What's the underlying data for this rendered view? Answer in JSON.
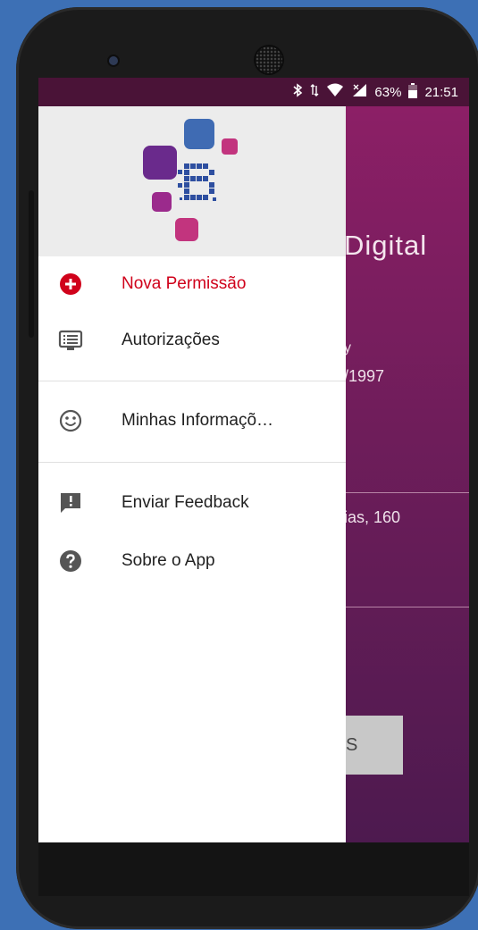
{
  "status_bar": {
    "battery": "63%",
    "time": "21:51"
  },
  "background_app": {
    "title_fragment": "Digital",
    "line1_fragment": "y",
    "line2_fragment": "/1997",
    "line3_fragment": "ias, 160",
    "button_fragment": "S"
  },
  "drawer": {
    "items": [
      {
        "label": "Nova Permissão",
        "icon": "add-circle-icon"
      },
      {
        "label": "Autorizações",
        "icon": "list-monitor-icon"
      },
      {
        "label": "Minhas Informaçõ…",
        "icon": "smiley-icon"
      },
      {
        "label": "Enviar Feedback",
        "icon": "feedback-icon"
      },
      {
        "label": "Sobre o App",
        "icon": "help-icon"
      }
    ]
  },
  "colors": {
    "accent": "#d0021b",
    "status_bar": "#4a1337",
    "app_primary": "#8c1f66",
    "drawer_header": "#ececec"
  }
}
